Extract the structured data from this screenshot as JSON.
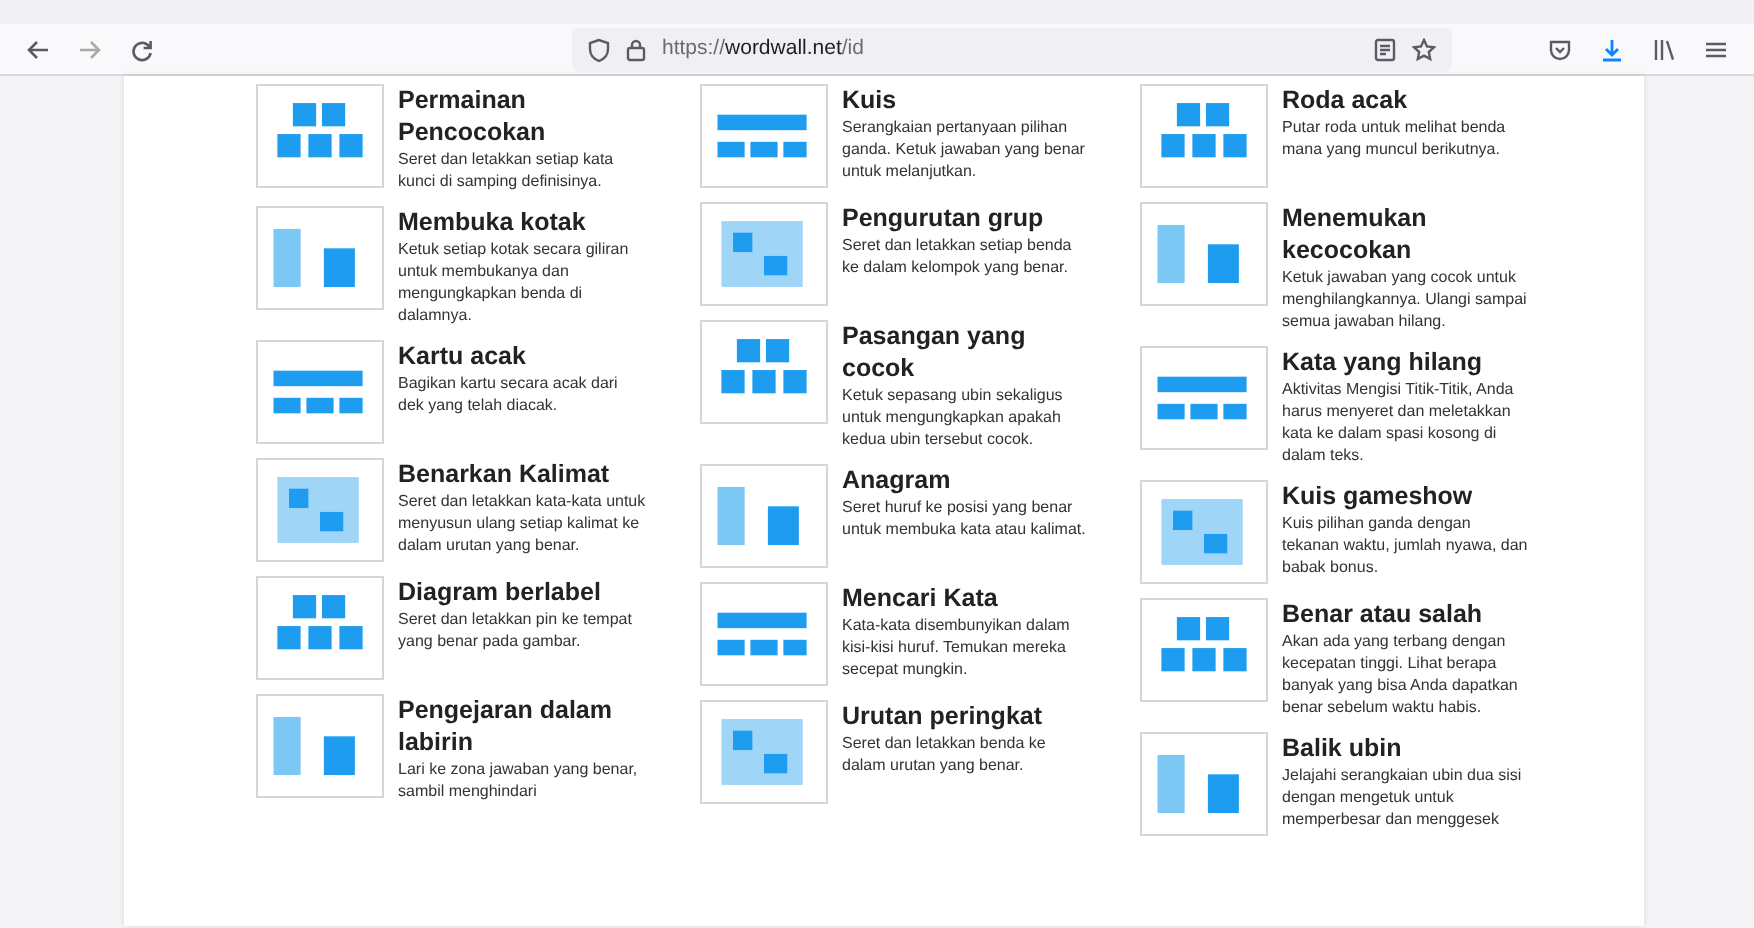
{
  "browser": {
    "url": "https://**wordwall.net**/id"
  },
  "columns": [
    {
      "items": [
        {
          "title": "Permainan Pencocokan",
          "description": "Seret dan letakkan setiap kata kunci di samping definisinya."
        },
        {
          "title": "Membuka kotak",
          "description": "Ketuk setiap kotak secara giliran untuk membukanya dan mengungkapkan benda di dalamnya."
        },
        {
          "title": "Kartu acak",
          "description": "Bagikan kartu secara acak dari dek yang telah diacak."
        },
        {
          "title": "Benarkan Kalimat",
          "description": "Seret dan letakkan kata-kata untuk menyusun ulang setiap kalimat ke dalam urutan yang benar."
        },
        {
          "title": "Diagram berlabel",
          "description": "Seret dan letakkan pin ke tempat yang benar pada gambar."
        },
        {
          "title": "Pengejaran dalam labirin",
          "description": "Lari ke zona jawaban yang benar, sambil menghindari"
        }
      ]
    },
    {
      "items": [
        {
          "title": "Kuis",
          "description": "Serangkaian pertanyaan pilihan ganda. Ketuk jawaban yang benar untuk melanjutkan."
        },
        {
          "title": "Pengurutan grup",
          "description": "Seret dan letakkan setiap benda ke dalam kelompok yang benar."
        },
        {
          "title": "Pasangan yang cocok",
          "description": "Ketuk sepasang ubin sekaligus untuk mengungkapkan apakah kedua ubin tersebut cocok."
        },
        {
          "title": "Anagram",
          "description": "Seret huruf ke posisi yang benar untuk membuka kata atau kalimat."
        },
        {
          "title": "Mencari Kata",
          "description": "Kata-kata disembunyikan dalam kisi-kisi huruf. Temukan mereka secepat mungkin."
        },
        {
          "title": "Urutan peringkat",
          "description": "Seret dan letakkan benda ke dalam urutan yang benar."
        }
      ]
    },
    {
      "items": [
        {
          "title": "Roda acak",
          "description": "Putar roda untuk melihat benda mana yang muncul berikutnya."
        },
        {
          "title": "Menemukan kecocokan",
          "description": "Ketuk jawaban yang cocok untuk menghilangkannya. Ulangi sampai semua jawaban hilang."
        },
        {
          "title": "Kata yang hilang",
          "description": "Aktivitas Mengisi Titik-Titik, Anda harus menyeret dan meletakkan kata ke dalam spasi kosong di dalam teks."
        },
        {
          "title": "Kuis gameshow",
          "description": "Kuis pilihan ganda dengan tekanan waktu, jumlah nyawa, dan babak bonus."
        },
        {
          "title": "Benar atau salah",
          "description": "Akan ada yang terbang dengan kecepatan tinggi. Lihat berapa banyak yang bisa Anda dapatkan benar sebelum waktu habis."
        },
        {
          "title": "Balik ubin",
          "description": "Jelajahi serangkaian ubin dua sisi dengan mengetuk untuk memperbesar dan menggesek"
        }
      ]
    }
  ]
}
